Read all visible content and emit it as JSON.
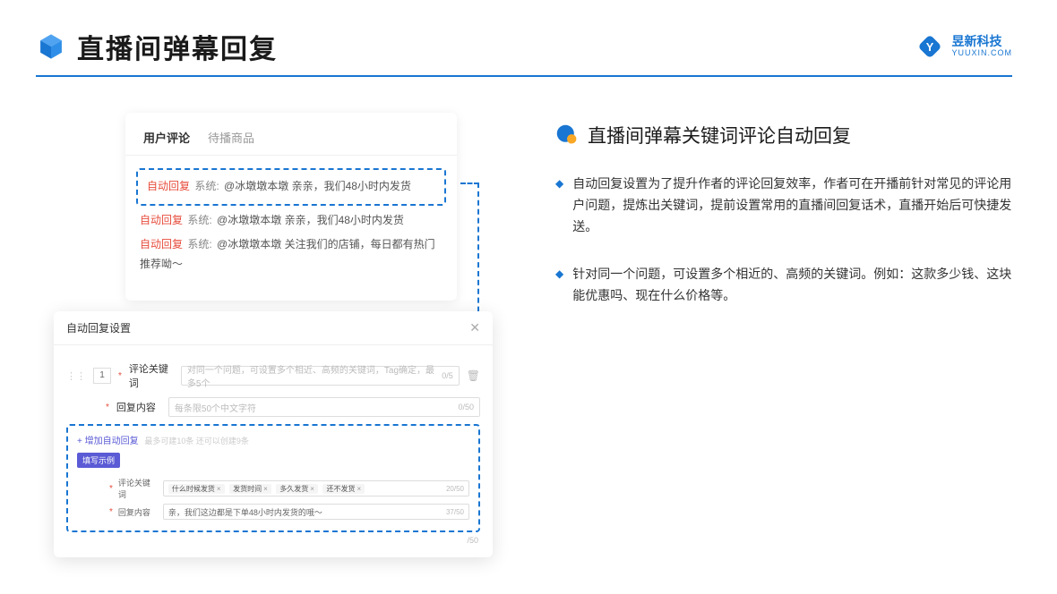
{
  "header": {
    "title": "直播间弹幕回复",
    "brand_cn": "昱新科技",
    "brand_en": "YUUXIN.COM"
  },
  "comment_card": {
    "tab_active": "用户评论",
    "tab_inactive": "待播商品",
    "items": [
      {
        "tag": "自动回复",
        "sys": "系统:",
        "text": "@冰墩墩本墩 亲亲，我们48小时内发货",
        "highlighted": true
      },
      {
        "tag": "自动回复",
        "sys": "系统:",
        "text": "@冰墩墩本墩 亲亲，我们48小时内发货",
        "highlighted": false
      },
      {
        "tag": "自动回复",
        "sys": "系统:",
        "text": "@冰墩墩本墩 关注我们的店铺，每日都有热门推荐呦～",
        "highlighted": false
      }
    ]
  },
  "settings": {
    "title": "自动回复设置",
    "index": "1",
    "keyword_label": "评论关键词",
    "keyword_placeholder": "对同一个问题，可设置多个相近、高频的关键词，Tag确定，最多5个",
    "keyword_count": "0/5",
    "content_label": "回复内容",
    "content_placeholder": "每条限50个中文字符",
    "content_count": "0/50",
    "add_link": "+ 增加自动回复",
    "add_hint": "最多可建10条 还可以创建9条",
    "example_badge": "填写示例",
    "example_keyword_label": "评论关键词",
    "example_tags": [
      "什么时候发货",
      "发货时间",
      "多久发货",
      "还不发货"
    ],
    "example_keyword_count": "20/50",
    "example_content_label": "回复内容",
    "example_content_text": "亲，我们这边都是下单48小时内发货的哦～",
    "example_content_count": "37/50",
    "bottom_count": "/50"
  },
  "right": {
    "heading": "直播间弹幕关键词评论自动回复",
    "bullets": [
      "自动回复设置为了提升作者的评论回复效率，作者可在开播前针对常见的评论用户问题，提炼出关键词，提前设置常用的直播间回复话术，直播开始后可快捷发送。",
      "针对同一个问题，可设置多个相近的、高频的关键词。例如：这款多少钱、这块能优惠吗、现在什么价格等。"
    ]
  }
}
